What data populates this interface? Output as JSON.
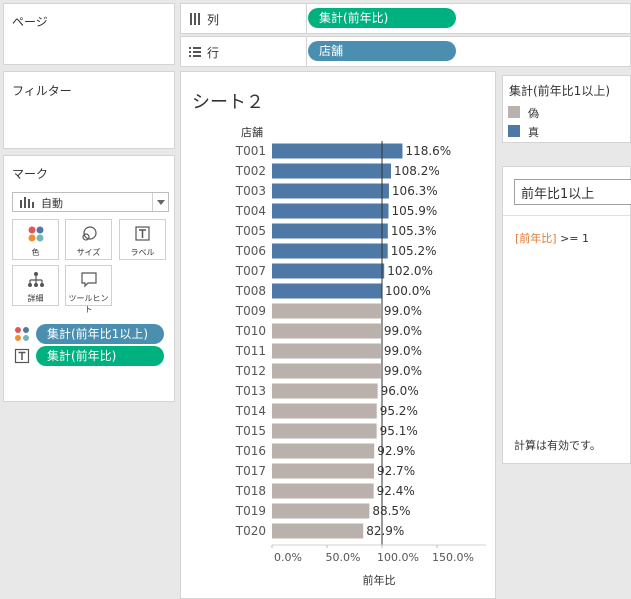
{
  "pages": {
    "title": "ページ"
  },
  "filters": {
    "title": "フィルター"
  },
  "marks": {
    "title": "マーク",
    "mark_type": "自動",
    "buttons": [
      {
        "label": "色",
        "icon": "color-icon"
      },
      {
        "label": "サイズ",
        "icon": "size-icon"
      },
      {
        "label": "ラベル",
        "icon": "label-icon"
      },
      {
        "label": "詳細",
        "icon": "detail-icon"
      },
      {
        "label": "ツールヒント",
        "icon": "tooltip-icon"
      }
    ],
    "color_pill": "集計(前年比1以上)",
    "label_pill": "集計(前年比)"
  },
  "shelves": {
    "columns_label": "列",
    "columns_pill": "集計(前年比)",
    "rows_label": "行",
    "rows_pill": "店舗"
  },
  "sheet": {
    "title": "シート２"
  },
  "legend": {
    "title": "集計(前年比1以上)",
    "items": [
      {
        "label": "偽",
        "color": "#bab0ac"
      },
      {
        "label": "真",
        "color": "#4e79a7"
      }
    ]
  },
  "calc": {
    "name": "前年比1以上",
    "formula_field": "[前年比]",
    "formula_rest": " >= 1",
    "status": "計算は有効です。"
  },
  "colors": {
    "true": "#4e79a7",
    "false": "#bab0ac",
    "pill_blue": "#4a8fb0",
    "pill_green": "#00b180"
  },
  "chart_data": {
    "type": "bar",
    "orientation": "horizontal",
    "row_header": "店舗",
    "xlabel": "前年比",
    "xlim": [
      0,
      175
    ],
    "xticks": [
      "0.0%",
      "50.0%",
      "100.0%",
      "150.0%"
    ],
    "xtick_values": [
      0,
      50,
      100,
      150
    ],
    "reference_line": 100,
    "categories": [
      "T001",
      "T002",
      "T003",
      "T004",
      "T005",
      "T006",
      "T007",
      "T008",
      "T009",
      "T010",
      "T011",
      "T012",
      "T013",
      "T014",
      "T015",
      "T016",
      "T017",
      "T018",
      "T019",
      "T020"
    ],
    "values": [
      118.6,
      108.2,
      106.3,
      105.9,
      105.3,
      105.2,
      102.0,
      100.0,
      99.0,
      99.0,
      99.0,
      99.0,
      96.0,
      95.2,
      95.1,
      92.9,
      92.7,
      92.4,
      88.5,
      82.9
    ],
    "data_labels": [
      "118.6%",
      "108.2%",
      "106.3%",
      "105.9%",
      "105.3%",
      "105.2%",
      "102.0%",
      "100.0%",
      "99.0%",
      "99.0%",
      "99.0%",
      "99.0%",
      "96.0%",
      "95.2%",
      "95.1%",
      "92.9%",
      "92.7%",
      "92.4%",
      "88.5%",
      "82.9%"
    ]
  }
}
